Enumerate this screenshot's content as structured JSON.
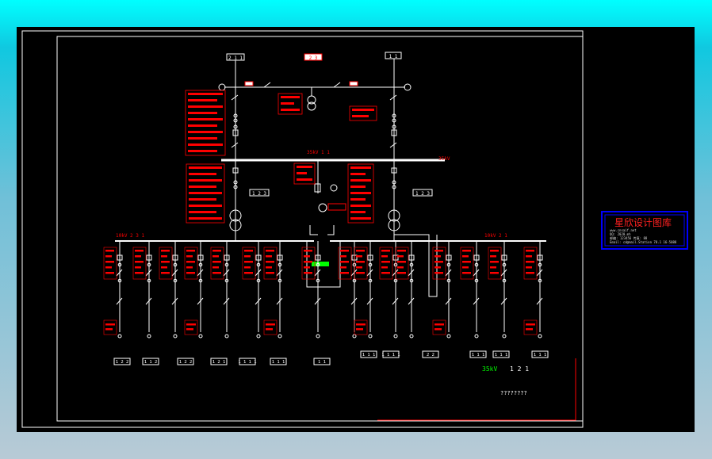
{
  "colors": {
    "background": "#000000",
    "frame": "#ffffff",
    "bus": "#ffffff",
    "labels": "#ff0000",
    "accent_green": "#00ff00",
    "accent_yellow": "#ffff00",
    "logo_border": "#0000ff",
    "logo_text": "#ff2020",
    "app_background_top": "#00ffff",
    "app_background_bottom": "#b8cad6"
  },
  "diagram": {
    "top_tags": [
      "2 1 1",
      "2 3",
      "1 1"
    ],
    "busbar_35kv_left_label": "35kV 1 1",
    "busbar_35kv_right_label": "35kV",
    "tag_plate_left": "1 2 3",
    "tag_plate_right": "1 2 3",
    "bus_10kv_left_label": "10kV 2 3 1",
    "bus_10kv_right_label": "10kV 2 1",
    "feeder_outlet_tags": [
      "1 2 2",
      "1 1 2",
      "1 2 2",
      "1 2 1",
      "1 1 1 1",
      "1 1 1",
      "1 1"
    ],
    "right_outlet_tags": [
      "1 1 1",
      "1 1 1 1",
      "2 2",
      "1 1 1",
      "1 1 1",
      "1 1 1"
    ],
    "title_block_voltage": "35kV",
    "title_block_number": "1 2 1",
    "title_block_name": "????????"
  },
  "watermark": {
    "title": "星欣设计图库",
    "line1": "www.cnsaif.net",
    "line2": "QQ: 2020.mh",
    "line3": "邮编: 123456 传真: 88",
    "line4": "Email: cd@mail.Station 78.1 16-5088"
  }
}
